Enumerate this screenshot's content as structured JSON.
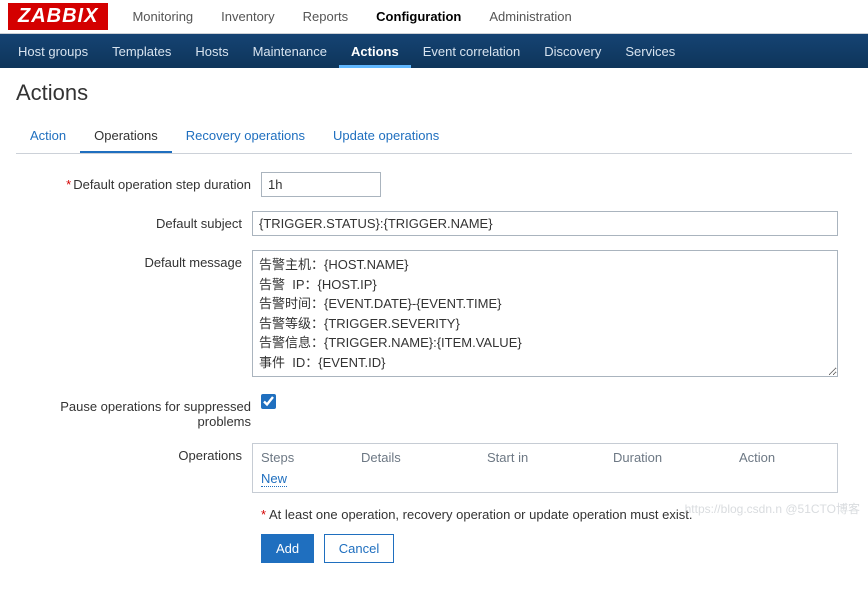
{
  "logo": "ZABBIX",
  "topnav": {
    "items": [
      "Monitoring",
      "Inventory",
      "Reports",
      "Configuration",
      "Administration"
    ],
    "active_index": 3
  },
  "subnav": {
    "items": [
      "Host groups",
      "Templates",
      "Hosts",
      "Maintenance",
      "Actions",
      "Event correlation",
      "Discovery",
      "Services"
    ],
    "active_index": 4
  },
  "page_title": "Actions",
  "tabs": {
    "items": [
      "Action",
      "Operations",
      "Recovery operations",
      "Update operations"
    ],
    "active_index": 1
  },
  "form": {
    "duration_label": "Default operation step duration",
    "duration_value": "1h",
    "subject_label": "Default subject",
    "subject_value": "{TRIGGER.STATUS}:{TRIGGER.NAME}",
    "message_label": "Default message",
    "message_value": "告警主机：{HOST.NAME}\n告警  IP：{HOST.IP}\n告警时间：{EVENT.DATE}-{EVENT.TIME}\n告警等级：{TRIGGER.SEVERITY}\n告警信息：{TRIGGER.NAME}:{ITEM.VALUE}\n事件  ID：{EVENT.ID}",
    "pause_label": "Pause operations for suppressed problems",
    "operations_label": "Operations",
    "ops_cols": {
      "steps": "Steps",
      "details": "Details",
      "startin": "Start in",
      "duration": "Duration",
      "action": "Action"
    },
    "ops_new": "New",
    "hint_star": "*",
    "hint_text": " At least one operation, recovery operation or update operation must exist.",
    "btn_add": "Add",
    "btn_cancel": "Cancel"
  },
  "watermark": "https://blog.csdn.n  @51CTO博客"
}
